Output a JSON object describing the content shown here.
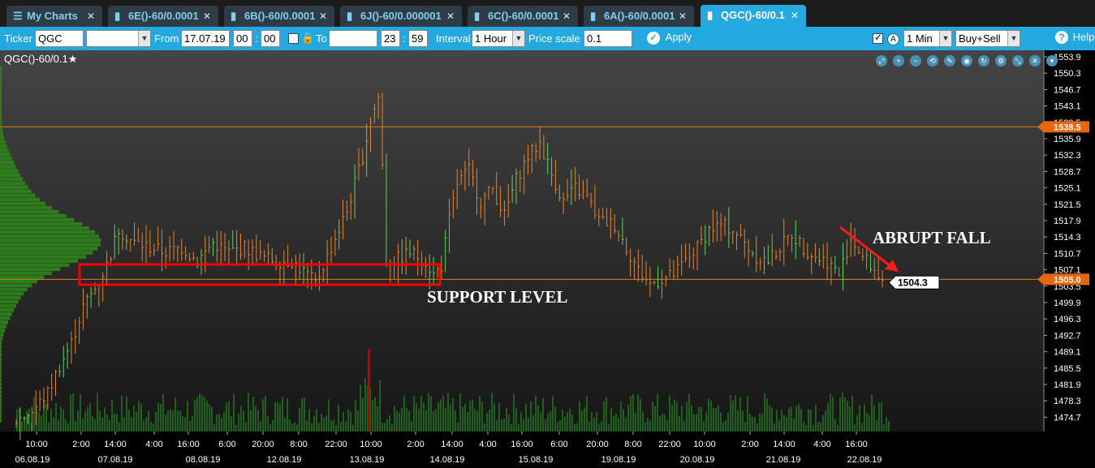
{
  "tabs": [
    {
      "label": "My Charts",
      "icon": "menu-icon",
      "active": false
    },
    {
      "label": "6E()-60/0.0001",
      "icon": "bar-chart-icon",
      "active": false
    },
    {
      "label": "6B()-60/0.0001",
      "icon": "bar-chart-icon",
      "active": false
    },
    {
      "label": "6J()-60/0.000001",
      "icon": "bar-chart-icon",
      "active": false
    },
    {
      "label": "6C()-60/0.0001",
      "icon": "bar-chart-icon",
      "active": false
    },
    {
      "label": "6A()-60/0.0001",
      "icon": "bar-chart-icon",
      "active": false
    },
    {
      "label": "QGC()-60/0.1",
      "icon": "bar-chart-icon",
      "active": true
    }
  ],
  "toolbar": {
    "ticker_label": "Ticker",
    "ticker_value": "QGC",
    "ticker_dropdown_value": "",
    "from_label": "From",
    "from_date": "17.07.19",
    "from_hour": "00",
    "from_minute": "00",
    "lock_checked": false,
    "to_label": "To",
    "to_date": "",
    "to_hour": "23",
    "to_minute": "59",
    "interval_label": "Interval",
    "interval_value": "1 Hour",
    "price_scale_label": "Price scale",
    "price_scale_value": "0.1",
    "apply_label": "Apply",
    "auto_checked": true,
    "auto_glyph": "A",
    "timeframe_value": "1 Min",
    "side_value": "Buy+Sell",
    "help_label": "Help",
    "separator": ":"
  },
  "chart": {
    "title": "QGC()-60/0.1",
    "favorite_glyph": "★",
    "toolbar_icons": [
      "zoom-fit-icon",
      "zoom-in-icon",
      "zoom-out-icon",
      "zoom-reset-icon",
      "pencil-icon",
      "eye-icon",
      "refresh-icon",
      "gear-icon",
      "expand-icon",
      "close-icon",
      "chevron-down-icon"
    ],
    "annotations": {
      "abrupt_fall": "ABRUPT FALL",
      "support_level": "SUPPORT LEVEL"
    },
    "colors": {
      "candle": "#e8842a",
      "candle_highlight": "#5cd65c",
      "level_line": "#e07a1f",
      "volume": "#1f7a1f",
      "volume_spike": "#c00000",
      "profile": "#2e8b1a",
      "annotation_box": "#ff0000",
      "accent": "#23a8e0"
    }
  },
  "chart_data": {
    "type": "candlestick",
    "price_axis_ticks": [
      "1553.9",
      "1550.3",
      "1546.7",
      "1543.1",
      "1539.5",
      "1535.9",
      "1532.3",
      "1528.7",
      "1525.1",
      "1521.5",
      "1517.9",
      "1514.3",
      "1510.7",
      "1507.1",
      "1503.5",
      "1499.9",
      "1496.3",
      "1492.7",
      "1489.1",
      "1485.5",
      "1481.9",
      "1478.3",
      "1474.7"
    ],
    "ylim": [
      1472.0,
      1555.5
    ],
    "time_axis_ticks": [
      "10:00",
      "2:00",
      "14:00",
      "4:00",
      "16:00",
      "6:00",
      "20:00",
      "8:00",
      "22:00",
      "10:00",
      "2:00",
      "14:00",
      "4:00",
      "16:00",
      "6:00",
      "20:00",
      "8:00",
      "22:00",
      "10:00",
      "2:00",
      "14:00",
      "4:00",
      "16:00"
    ],
    "date_axis_ticks": [
      "06.08.19",
      "07.08.19",
      "08.08.19",
      "12.08.19",
      "13.08.19",
      "14.08.19",
      "15.08.19",
      "19.08.19",
      "20.08.19",
      "21.08.19",
      "22.08.19"
    ],
    "levels": [
      {
        "price": 1538.5,
        "label": "1538.5"
      },
      {
        "price": 1505.0,
        "label": "1505.0"
      }
    ],
    "last_price": {
      "price": 1504.3,
      "label": "1504.3"
    },
    "close_path": [
      [
        0,
        1474
      ],
      [
        4,
        1476
      ],
      [
        8,
        1480
      ],
      [
        11,
        1486
      ],
      [
        14,
        1491
      ],
      [
        17,
        1499
      ],
      [
        20,
        1503
      ],
      [
        23,
        1508
      ],
      [
        26,
        1516
      ],
      [
        30,
        1513
      ],
      [
        34,
        1512
      ],
      [
        38,
        1511
      ],
      [
        42,
        1512
      ],
      [
        46,
        1509
      ],
      [
        50,
        1513
      ],
      [
        54,
        1511
      ],
      [
        58,
        1512
      ],
      [
        62,
        1510
      ],
      [
        66,
        1509
      ],
      [
        70,
        1509
      ],
      [
        74,
        1506
      ],
      [
        76,
        1504
      ],
      [
        78,
        1508
      ],
      [
        81,
        1514
      ],
      [
        84,
        1520
      ],
      [
        86,
        1526
      ],
      [
        88,
        1532
      ],
      [
        90,
        1540
      ],
      [
        92,
        1545
      ],
      [
        93,
        1530
      ],
      [
        94,
        1509
      ],
      [
        96,
        1509
      ],
      [
        100,
        1511
      ],
      [
        104,
        1509
      ],
      [
        106,
        1506
      ],
      [
        108,
        1508
      ],
      [
        110,
        1518
      ],
      [
        112,
        1526
      ],
      [
        115,
        1529
      ],
      [
        118,
        1522
      ],
      [
        121,
        1525
      ],
      [
        124,
        1519
      ],
      [
        127,
        1527
      ],
      [
        130,
        1532
      ],
      [
        133,
        1535
      ],
      [
        136,
        1528
      ],
      [
        139,
        1522
      ],
      [
        142,
        1525
      ],
      [
        145,
        1523
      ],
      [
        148,
        1518
      ],
      [
        152,
        1517
      ],
      [
        155,
        1512
      ],
      [
        158,
        1507
      ],
      [
        161,
        1504
      ],
      [
        164,
        1505
      ],
      [
        167,
        1506
      ],
      [
        170,
        1509
      ],
      [
        173,
        1512
      ],
      [
        176,
        1516
      ],
      [
        179,
        1517
      ],
      [
        182,
        1516
      ],
      [
        185,
        1513
      ],
      [
        188,
        1510
      ],
      [
        191,
        1509
      ],
      [
        194,
        1512
      ],
      [
        197,
        1515
      ],
      [
        200,
        1512
      ],
      [
        203,
        1510
      ],
      [
        206,
        1509
      ],
      [
        209,
        1506
      ],
      [
        212,
        1514
      ],
      [
        215,
        1510
      ],
      [
        218,
        1507
      ],
      [
        221,
        1504
      ]
    ],
    "volume_profile_note": "volume-by-price histogram on left edge",
    "volume_bars_note": "hourly volume bars along bottom, spike at 13.08.19 10:00"
  }
}
